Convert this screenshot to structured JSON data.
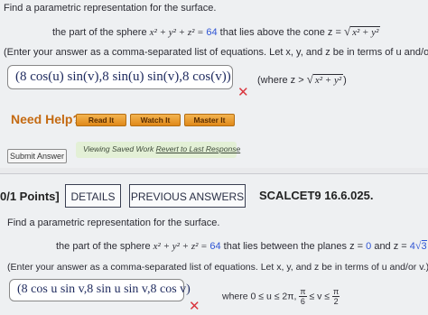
{
  "q1": {
    "prompt": "Find a parametric representation for the surface.",
    "surface_prefix": "the part of the sphere ",
    "surface_eq_lhs": "x² + y² + z² = ",
    "surface_eq_val": "64",
    "surface_suffix": " that lies above the cone z = ",
    "cone_expr": "x² + y²",
    "instructions": "(Enter your answer as a comma-separated list of equations. Let x, y, and z be in terms of u and/or v.",
    "answer": "(8 cos(u) sin(v),8 sin(u) sin(v),8 cos(v))",
    "where_prefix": "(where z > ",
    "where_expr": "x² + y²",
    "where_suffix": ")",
    "incorrect_mark": "✕"
  },
  "help": {
    "label": "Need Help?",
    "buttons": [
      "Read It",
      "Watch It",
      "Master It"
    ]
  },
  "submit_label": "Submit Answer",
  "saved": {
    "prefix": "Viewing Saved Work ",
    "link": "Revert to Last Response"
  },
  "q2_header": {
    "points": "0/1 Points]",
    "details": "DETAILS",
    "previous": "PREVIOUS ANSWERS",
    "code": "SCALCET9 16.6.025."
  },
  "q2": {
    "prompt": "Find a parametric representation for the surface.",
    "surface_prefix": "the part of the sphere ",
    "surface_eq_lhs": "x² + y² + z² = ",
    "surface_eq_val": "64",
    "surface_mid": " that lies between the planes z = ",
    "plane1": "0",
    "and_text": " and z = ",
    "plane2_coef": "4",
    "plane2_rad": "3",
    "instructions": "(Enter your answer as a comma-separated list of equations. Let x, y, and z be in terms of u and/or v.)",
    "answer": "(8 cos u sin v,8 sin u sin v,8 cos v)",
    "where_text": "where 0 ≤ u ≤ 2π, ",
    "frac1_num": "π",
    "frac1_den": "6",
    "leq_v_leq": " ≤ v ≤ ",
    "frac2_num": "π",
    "frac2_den": "2",
    "incorrect_mark": "✕"
  }
}
